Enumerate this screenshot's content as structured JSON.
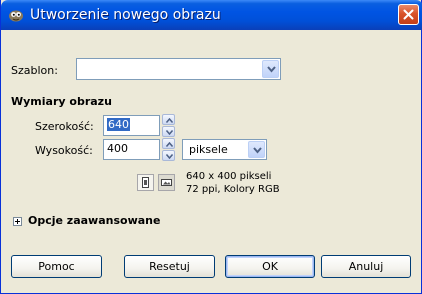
{
  "window": {
    "title": "Utworzenie nowego obrazu"
  },
  "template": {
    "label": "Szablon:",
    "value": ""
  },
  "image_size": {
    "heading": "Wymiary obrazu",
    "width_label": "Szerokość:",
    "width_value": "640",
    "height_label": "Wysokość:",
    "height_value": "400",
    "unit": "piksele",
    "info_line1": "640 x 400 pikseli",
    "info_line2": "72 ppi, Kolory RGB"
  },
  "advanced": {
    "label": "Opcje zaawansowane"
  },
  "buttons": {
    "help": "Pomoc",
    "reset": "Resetuj",
    "ok": "OK",
    "cancel": "Anuluj"
  },
  "icons": [
    "gimp-app-icon",
    "close-icon",
    "chevron-down-icon",
    "spin-up-icon",
    "spin-down-icon",
    "portrait-icon",
    "landscape-icon",
    "expand-icon"
  ]
}
